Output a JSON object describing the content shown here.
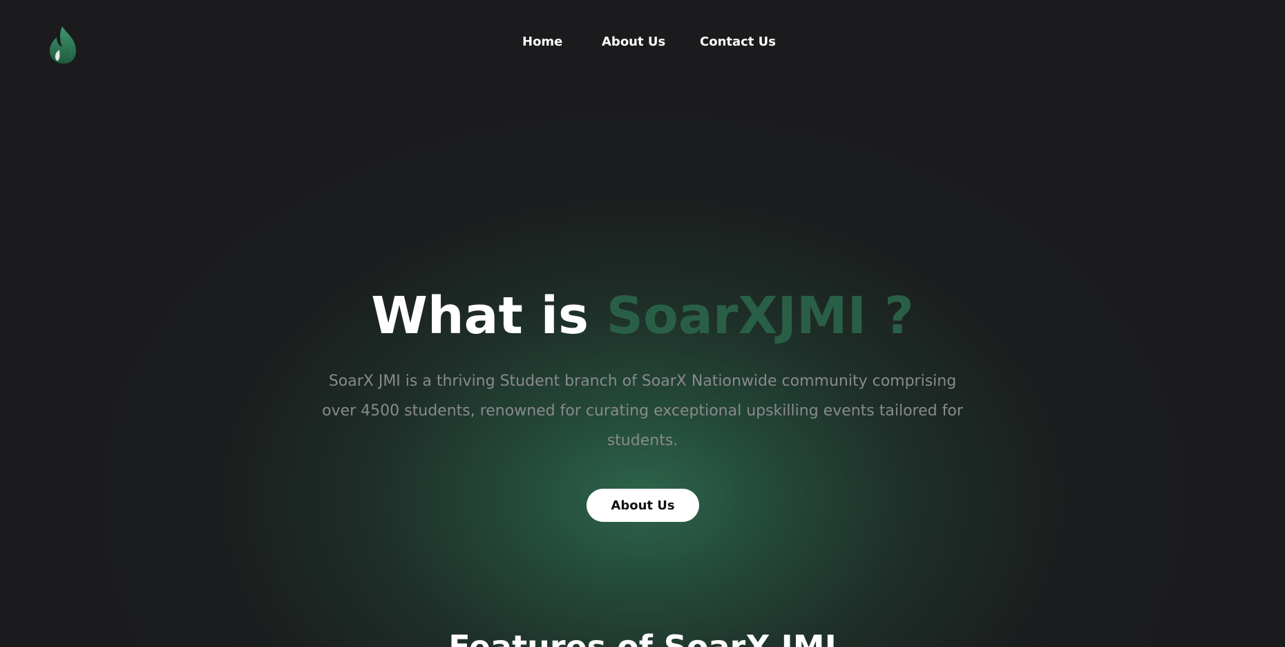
{
  "brand": {
    "logo_icon": "green-flame-icon",
    "accent_color": "#2a5f47",
    "background_color": "#1b1b1d"
  },
  "nav": {
    "items": [
      {
        "label": "Home"
      },
      {
        "label": "About Us"
      },
      {
        "label": "Contact Us"
      }
    ]
  },
  "hero": {
    "title_plain": "What is",
    "title_accent": "SoarXJMI ?",
    "description": "SoarX JMI is a thriving Student branch of SoarX Nationwide community comprising over 4500 students, renowned for curating exceptional upskilling events tailored for students.",
    "cta_label": "About Us"
  },
  "features": {
    "heading": "Features of SoarX JMI"
  }
}
